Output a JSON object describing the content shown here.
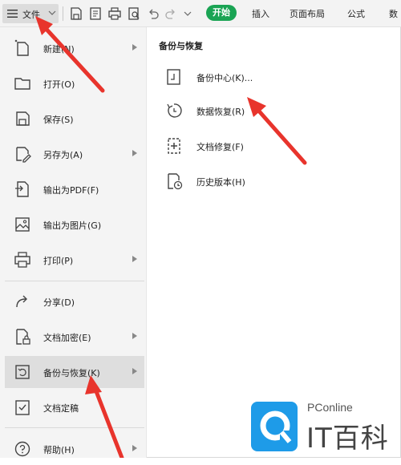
{
  "toolbar": {
    "file_label": "文件",
    "tabs": [
      "开始",
      "插入",
      "页面布局",
      "公式",
      "数"
    ],
    "accent_color": "#1aa454"
  },
  "left_menu": {
    "items": [
      {
        "label": "新建(N)",
        "icon": "new-doc-icon",
        "has_submenu": true
      },
      {
        "label": "打开(O)",
        "icon": "folder-icon",
        "has_submenu": false
      },
      {
        "label": "保存(S)",
        "icon": "save-icon",
        "has_submenu": false
      },
      {
        "label": "另存为(A)",
        "icon": "save-as-icon",
        "has_submenu": true
      },
      {
        "label": "输出为PDF(F)",
        "icon": "pdf-icon",
        "has_submenu": false
      },
      {
        "label": "输出为图片(G)",
        "icon": "image-icon",
        "has_submenu": false
      },
      {
        "label": "打印(P)",
        "icon": "print-icon",
        "has_submenu": true
      },
      {
        "label": "分享(D)",
        "icon": "share-icon",
        "has_submenu": false
      },
      {
        "label": "文档加密(E)",
        "icon": "encrypt-icon",
        "has_submenu": true
      },
      {
        "label": "备份与恢复(K)",
        "icon": "backup-icon",
        "has_submenu": true,
        "selected": true
      },
      {
        "label": "文档定稿",
        "icon": "finalize-icon",
        "has_submenu": false
      },
      {
        "label": "帮助(H)",
        "icon": "help-icon",
        "has_submenu": true
      }
    ]
  },
  "submenu": {
    "title": "备份与恢复",
    "items": [
      {
        "label": "备份中心(K)...",
        "icon": "backup-center-icon"
      },
      {
        "label": "数据恢复(R)",
        "icon": "data-recovery-icon"
      },
      {
        "label": "文档修复(F)",
        "icon": "doc-repair-icon"
      },
      {
        "label": "历史版本(H)",
        "icon": "history-version-icon"
      }
    ]
  },
  "watermark": {
    "brand": "PConline",
    "name": "IT百科"
  },
  "annotation_color": "#e8342c"
}
